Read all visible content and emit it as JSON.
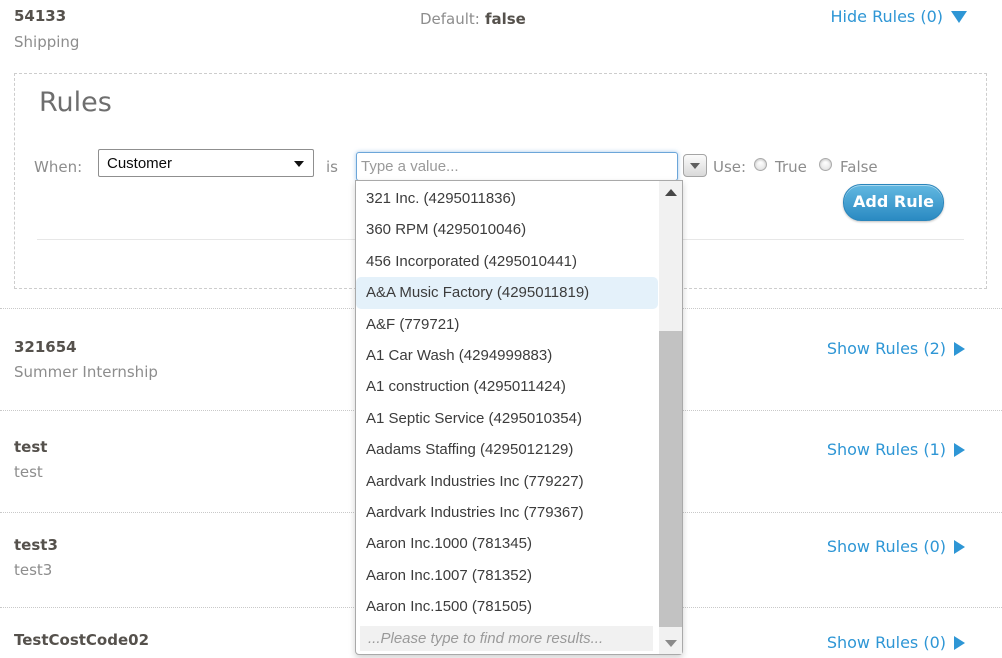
{
  "header": {
    "code": "54133",
    "name": "Shipping",
    "default_label": "Default:",
    "default_value": "false",
    "rules_toggle_label": "Hide Rules (0)"
  },
  "rules_panel": {
    "title": "Rules",
    "when_label": "When:",
    "field_select_value": "Customer",
    "is_label": "is",
    "value_input_placeholder": "Type a value...",
    "use_label": "Use:",
    "radio_true_label": "True",
    "radio_false_label": "False",
    "add_rule_label": "Add Rule"
  },
  "value_dropdown": {
    "items": [
      "321 Inc. (4295011836)",
      "360 RPM (4295010046)",
      "456 Incorporated (4295010441)",
      "A&A Music Factory (4295011819)",
      "A&F (779721)",
      "A1 Car Wash (4294999883)",
      "A1 construction (4295011424)",
      "A1 Septic Service (4295010354)",
      "Aadams Staffing (4295012129)",
      "Aardvark Industries Inc (779227)",
      "Aardvark Industries Inc (779367)",
      "Aaron Inc.1000 (781345)",
      "Aaron Inc.1007 (781352)",
      "Aaron Inc.1500 (781505)"
    ],
    "highlighted_index": 3,
    "more_results_hint": "...Please type to find more results..."
  },
  "cost_code_rows": [
    {
      "code": "321654",
      "name": "Summer Internship",
      "rules_link": "Show Rules (2)"
    },
    {
      "code": "test",
      "name": "test",
      "rules_link": "Show Rules (1)"
    },
    {
      "code": "test3",
      "name": "test3",
      "rules_link": "Show Rules (0)"
    },
    {
      "code": "TestCostCode02",
      "name": "",
      "rules_link": "Show Rules (0)"
    }
  ],
  "colors": {
    "link_blue": "#2e96d5",
    "title_gray": "#55514c",
    "text_gray": "#8d8d8d",
    "highlight_row_bg": "#e4f1fa",
    "input_focus_border": "#6ca6d9",
    "button_gradient_top": "#62b8e1",
    "button_gradient_bottom": "#2a8ac2"
  }
}
